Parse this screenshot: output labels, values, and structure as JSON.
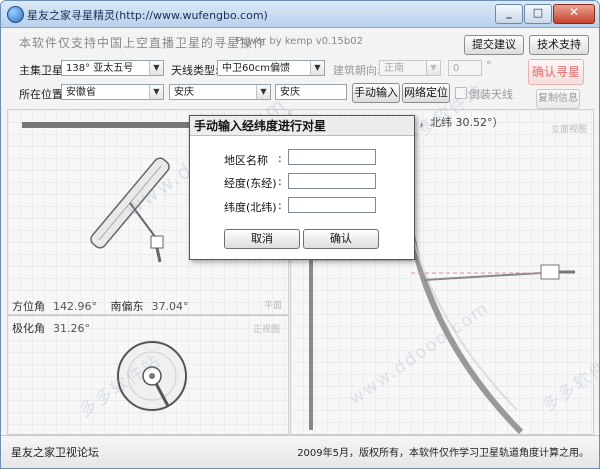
{
  "window": {
    "title": "星友之家寻星精灵(http://www.wufengbo.com)",
    "minimize_glyph": "_",
    "maximize_glyph": "□",
    "close_glyph": "✕"
  },
  "header": {
    "slogan": "本软件仅支持中国上空直播卫星的寻星操作",
    "version": "Power by kemp  v0.15b02",
    "submit_button": "提交建议",
    "support_button": "技术支持"
  },
  "form": {
    "satellite_label": "主集卫星:",
    "satellite_value": "138°  亚太五号",
    "antenna_label": "天线类型:",
    "antenna_value": "中卫60cm偏馈",
    "building_label": "建筑朝向:",
    "building_value": "正南",
    "building_degree": "0",
    "degree_unit": "°",
    "location_label": "所在位置:",
    "province_value": "安徽省",
    "city_value": "安庆",
    "place_value": "安庆",
    "manual_button": "手动输入",
    "network_button": "网络定位",
    "inverted_label": "倒装天线",
    "confirm_star_button": "确认寻星",
    "copy_info_button": "复制信息"
  },
  "readouts": {
    "coord_fragment": "，北纬 30.52°）",
    "elevation_tag": "立面视图",
    "azimuth_label": "方位角",
    "azimuth_value": "142.96°",
    "southeast_label": "南偏东",
    "southeast_value": "37.04°",
    "plan_tag": "平面",
    "polarization_label": "极化角",
    "polarization_value": "31.26°",
    "front_tag": "正视图"
  },
  "dialog": {
    "title": "手动输入经纬度进行对星",
    "region_label": "地区名称",
    "longitude_label": "经度(东经)",
    "latitude_label": "纬度(北纬)",
    "colon": ":",
    "region_value": "",
    "longitude_value": "",
    "latitude_value": "",
    "cancel_button": "取消",
    "ok_button": "确认"
  },
  "status": {
    "forum": "星友之家卫视论坛",
    "copyright": "2009年5月，版权所有，本软件仅作学习卫星轨道角度计算之用。"
  },
  "watermarks": {
    "text": "多多软件站",
    "url": "www.ddooo.com"
  },
  "colors": {
    "confirm_star": "#e36c6c",
    "titlebar": "#c6d9ef"
  }
}
